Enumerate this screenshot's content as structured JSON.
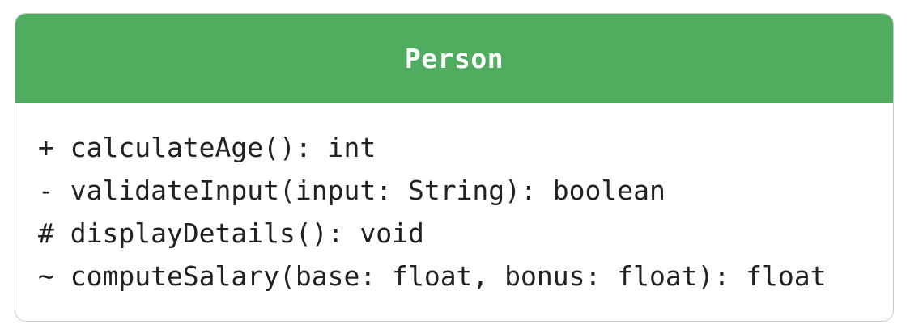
{
  "class": {
    "name": "Person",
    "methods": [
      "+ calculateAge(): int",
      "- validateInput(input: String): boolean",
      "# displayDetails(): void",
      "~ computeSalary(base: float, bonus: float): float"
    ]
  },
  "colors": {
    "header_background": "#50ad5f",
    "header_text": "#ffffff",
    "body_text": "#222222",
    "border": "#c9c9c9"
  }
}
